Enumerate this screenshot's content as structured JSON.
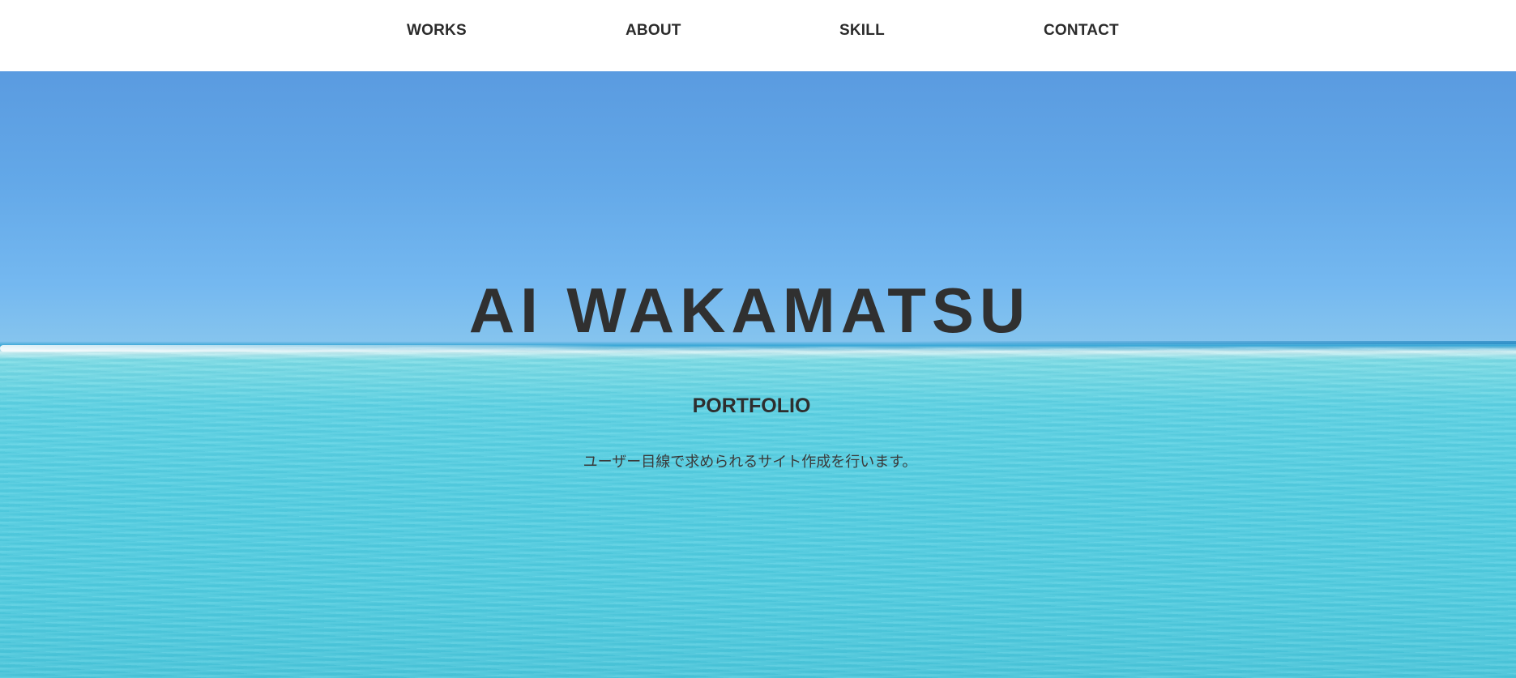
{
  "nav": {
    "items": [
      {
        "label": "WORKS"
      },
      {
        "label": "ABOUT"
      },
      {
        "label": "SKILL"
      },
      {
        "label": "CONTACT"
      }
    ]
  },
  "hero": {
    "title": "AI WAKAMATSU",
    "subtitle": "PORTFOLIO",
    "tagline": "ユーザー目線で求められるサイト作成を行います。",
    "background": "ocean-horizon-photo"
  },
  "colors": {
    "nav_background": "#ffffff",
    "text": "#333333",
    "sky": "#5a9be0",
    "sea": "#52cde0"
  }
}
